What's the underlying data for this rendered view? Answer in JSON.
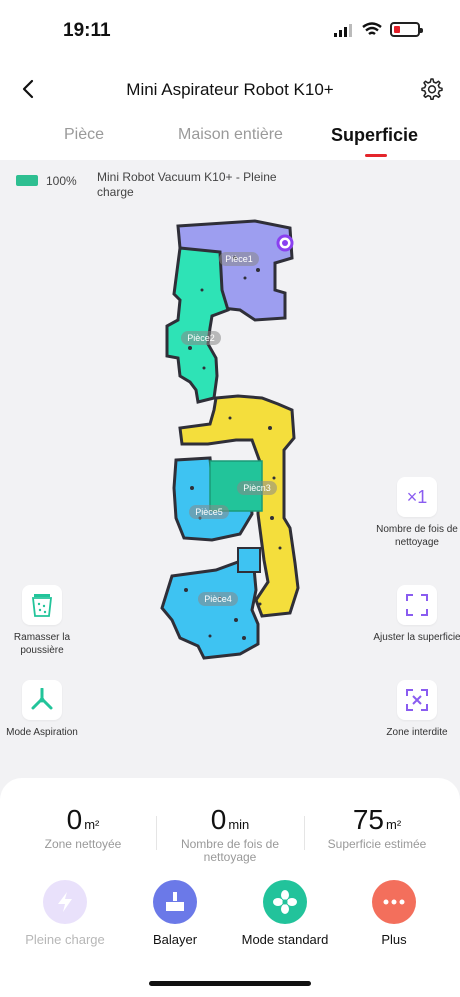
{
  "status_bar": {
    "time": "19:11"
  },
  "nav": {
    "title": "Mini Aspirateur Robot K10+"
  },
  "tabs": [
    "Pièce",
    "Maison entière",
    "Superficie"
  ],
  "device": {
    "battery_percent": "100%",
    "battery_level": 1.0,
    "name_status": "Mini Robot Vacuum K10+ - Pleine charge"
  },
  "map": {
    "rooms": [
      "Pièce1",
      "Pièce2",
      "Piècn3",
      "Pièce5",
      "Pièce4"
    ]
  },
  "tools_left": [
    {
      "label": "Ramasser la poussière",
      "icon": "dust-bin-icon"
    },
    {
      "label": "Mode Aspiration",
      "icon": "fan-icon"
    }
  ],
  "tools_right": [
    {
      "label": "Nombre de fois de nettoyage",
      "icon_text": "×1"
    },
    {
      "label": "Ajuster la superficie",
      "icon": "frame-icon"
    },
    {
      "label": "Zone interdite",
      "icon": "no-go-zone-icon"
    }
  ],
  "stats": [
    {
      "value": "0",
      "unit": "m²",
      "label": "Zone nettoyée"
    },
    {
      "value": "0",
      "unit": "min",
      "label": "Nombre de fois de nettoyage"
    },
    {
      "value": "75",
      "unit": "m²",
      "label": "Superficie estimée"
    }
  ],
  "actions": [
    {
      "label": "Pleine charge",
      "icon": "lightning-icon",
      "color": "#e9e1fb",
      "disabled": true
    },
    {
      "label": "Balayer",
      "icon": "sweep-icon",
      "color": "#6b79e8"
    },
    {
      "label": "Mode standard",
      "icon": "fan-icon",
      "color": "#22c39b"
    },
    {
      "label": "Plus",
      "icon": "more-icon",
      "color": "#f36f5c"
    }
  ],
  "colors": {
    "accent_red": "#e4252b",
    "room_purple": "#9d9ef0",
    "room_teal": "#2ee3b6",
    "room_yellow": "#f4de3c",
    "room_blue": "#3ec3f2",
    "room_green": "#22c49a",
    "wall": "#2f2f38"
  }
}
